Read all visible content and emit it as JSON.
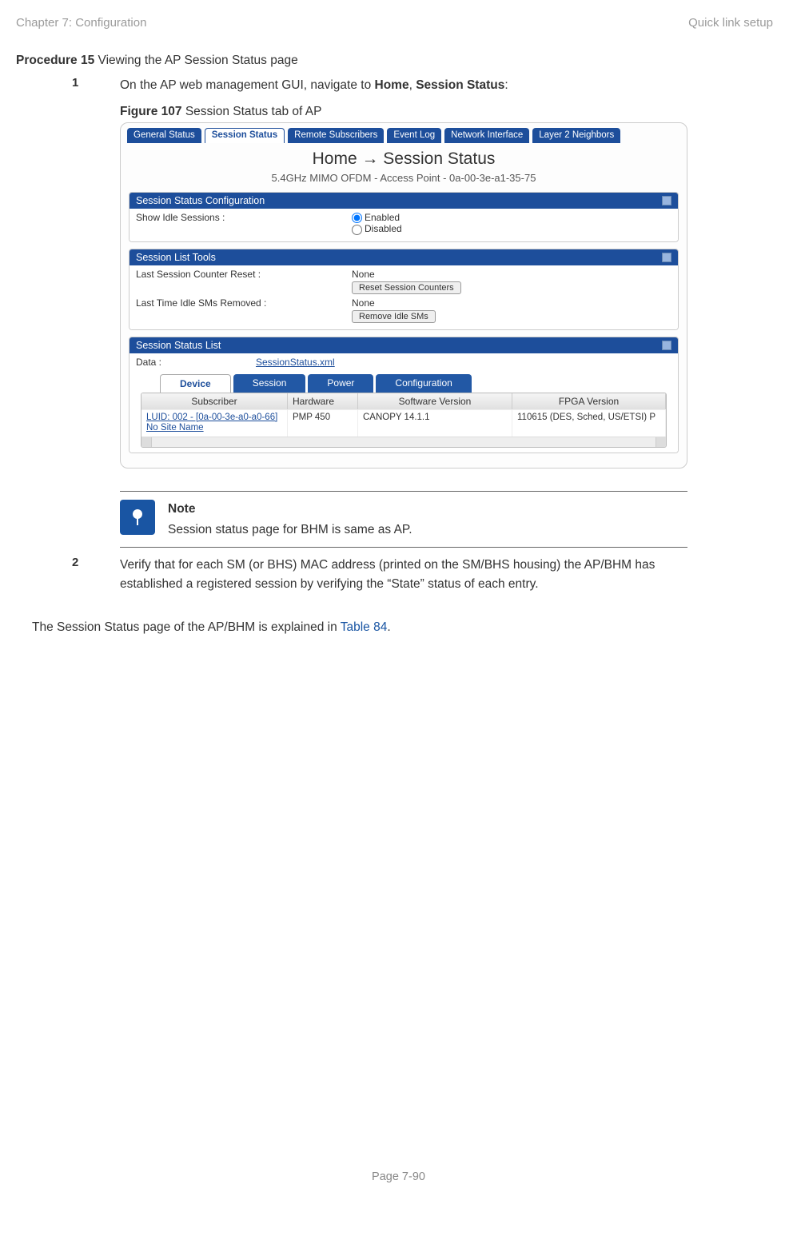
{
  "header": {
    "left": "Chapter 7:  Configuration",
    "right": "Quick link setup"
  },
  "procedure": {
    "label": "Procedure 15",
    "title": " Viewing the AP Session Status page"
  },
  "step1": {
    "num": "1",
    "pre": "On the AP web management GUI, navigate to ",
    "home": "Home",
    "sep": ", ",
    "ss": "Session Status",
    "post": ":"
  },
  "figure": {
    "label": "Figure 107",
    "title": " Session Status tab of AP"
  },
  "gui": {
    "tabs": [
      "General Status",
      "Session Status",
      "Remote Subscribers",
      "Event Log",
      "Network Interface",
      "Layer 2 Neighbors"
    ],
    "title": "Home → Session Status",
    "subtitle": "5.4GHz MIMO OFDM - Access Point - 0a-00-3e-a1-35-75",
    "panel1": {
      "title": "Session Status Configuration",
      "row_label": "Show Idle Sessions :",
      "opt_enabled": "Enabled",
      "opt_disabled": "Disabled"
    },
    "panel2": {
      "title": "Session List Tools",
      "r1_label": "Last Session Counter Reset :",
      "r1_val": "None",
      "r1_btn": "Reset Session Counters",
      "r2_label": "Last Time Idle SMs Removed :",
      "r2_val": "None",
      "r2_btn": "Remove Idle SMs"
    },
    "panel3": {
      "title": "Session Status List",
      "data_label": "Data :",
      "data_link": "SessionStatus.xml",
      "inner_tabs": [
        "Device",
        "Session",
        "Power",
        "Configuration"
      ],
      "cols": {
        "sub": "Subscriber",
        "hw": "Hardware",
        "sw": "Software Version",
        "fp": "FPGA Version"
      },
      "row": {
        "sub_l1": "LUID: 002 - [0a-00-3e-a0-a0-66]",
        "sub_l2": "No Site Name",
        "hw": "PMP 450",
        "sw": "CANOPY 14.1.1",
        "fp": "110615 (DES, Sched, US/ETSI) P"
      }
    }
  },
  "note": {
    "title": "Note",
    "body": "Session status page for BHM is same as AP."
  },
  "step2": {
    "num": "2",
    "body": "Verify that for each SM (or BHS) MAC address (printed on the SM/BHS housing) the AP/BHM has established a registered session by verifying the “State” status of each entry."
  },
  "paragraph": {
    "pre": "The Session Status page of the AP/BHM is explained in ",
    "link": "Table 84",
    "post": "."
  },
  "footer": "Page 7-90"
}
